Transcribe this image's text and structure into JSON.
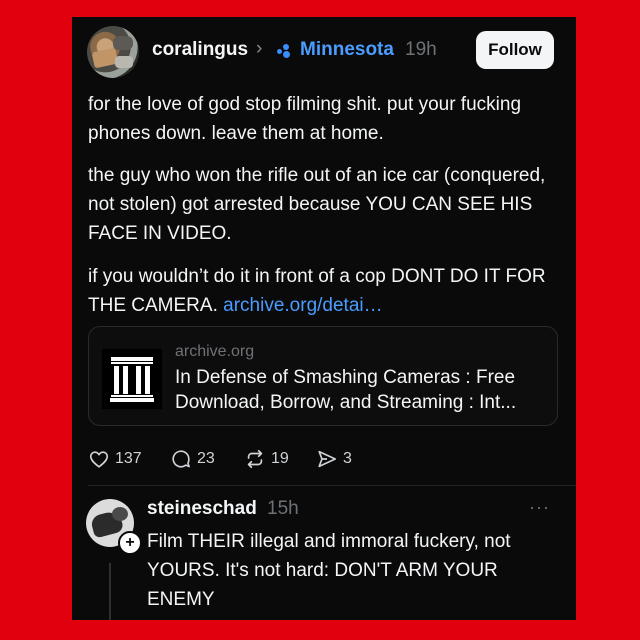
{
  "post": {
    "author": "coralingus",
    "community": "Minnesota",
    "time": "19h",
    "follow_label": "Follow",
    "paragraph_1": "for the love of god stop filming shit. put your fucking phones down. leave them at home.",
    "paragraph_2": "the guy who won the rifle out of an ice car (conquered, not stolen) got arrested because YOU CAN SEE HIS FACE IN VIDEO.",
    "paragraph_3": "if you wouldn’t do it in front of a cop DONT DO IT FOR THE CAMERA.",
    "link_text": "archive.org/detai…",
    "accent_color": "#4a9cff",
    "link_preview": {
      "domain": "archive.org",
      "title": "In Defense of Smashing Cameras : Free Download, Borrow, and Streaming : Int..."
    },
    "actions": {
      "likes": "137",
      "comments": "23",
      "reposts": "19",
      "shares": "3"
    }
  },
  "reply": {
    "author": "steineschad",
    "time": "15h",
    "more_label": "···",
    "text": "Film THEIR illegal and immoral fuckery, not YOURS. It's not hard: DON'T ARM YOUR ENEMY",
    "plus_label": "+"
  },
  "icons": [
    "chevron-right-icon",
    "community-icon",
    "archive-logo-icon",
    "heart-icon",
    "comment-icon",
    "repost-icon",
    "share-icon",
    "more-icon",
    "plus-icon"
  ]
}
